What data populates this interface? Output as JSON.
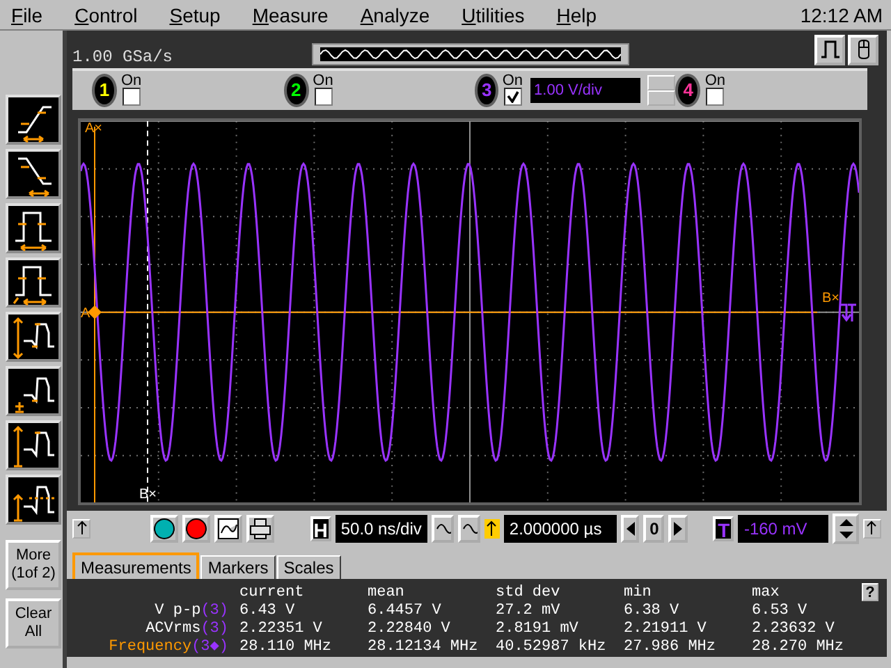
{
  "menu": {
    "items": [
      "File",
      "Control",
      "Setup",
      "Measure",
      "Analyze",
      "Utilities",
      "Help"
    ],
    "clock": "12:12 AM"
  },
  "sample_rate": "1.00 GSa/s",
  "channels": [
    {
      "number": "1",
      "label": "On",
      "on": false,
      "color": "#ffff00"
    },
    {
      "number": "2",
      "label": "On",
      "on": false,
      "color": "#00ff00"
    },
    {
      "number": "3",
      "label": "On",
      "on": true,
      "color": "#9933ff",
      "scale": "1.00 V/div"
    },
    {
      "number": "4",
      "label": "On",
      "on": false,
      "color": "#ff3399"
    }
  ],
  "tools": [
    {
      "kind": "rise"
    },
    {
      "kind": "fall"
    },
    {
      "kind": "period"
    },
    {
      "kind": "duty"
    },
    {
      "kind": "pp"
    },
    {
      "kind": "min"
    },
    {
      "kind": "amp"
    },
    {
      "kind": "avg"
    }
  ],
  "side_buttons": [
    "More\n(1of 2)",
    "Clear\nAll"
  ],
  "markers": [
    {
      "kind": "top",
      "label": "A×"
    },
    {
      "kind": "bottom",
      "label": "B×"
    },
    {
      "kind": "left",
      "label": "A"
    },
    {
      "kind": "right",
      "label": "B×"
    }
  ],
  "timebase": {
    "label": "H",
    "scale": "50.0 ns/div",
    "delay": "2.000000 µs",
    "zero": "0"
  },
  "trigger": {
    "label": "T",
    "level": "-160 mV"
  },
  "tabs": [
    {
      "label": "Measurements",
      "selected": true
    },
    {
      "label": "Markers",
      "selected": false
    },
    {
      "label": "Scales",
      "selected": false
    }
  ],
  "help": "?",
  "measurements": {
    "columns": [
      "current",
      "mean",
      "std dev",
      "min",
      "max"
    ],
    "rows": [
      {
        "name": "V p-p",
        "source": "(3)",
        "highlighted": false,
        "values": [
          "6.43 V",
          "6.4457 V",
          "27.2 mV",
          "6.38 V",
          "6.53 V"
        ]
      },
      {
        "name": "ACVrms",
        "source": "(3)",
        "highlighted": false,
        "values": [
          "2.22351 V",
          "2.22840 V",
          "2.8191 mV",
          "2.21911 V",
          "2.23632 V"
        ]
      },
      {
        "name": "Frequency",
        "source": "(3◆)",
        "highlighted": true,
        "values": [
          "28.110 MHz",
          "28.12134 MHz",
          "40.52987 kHz",
          "27.986 MHz",
          "28.270 MHz"
        ]
      }
    ]
  }
}
